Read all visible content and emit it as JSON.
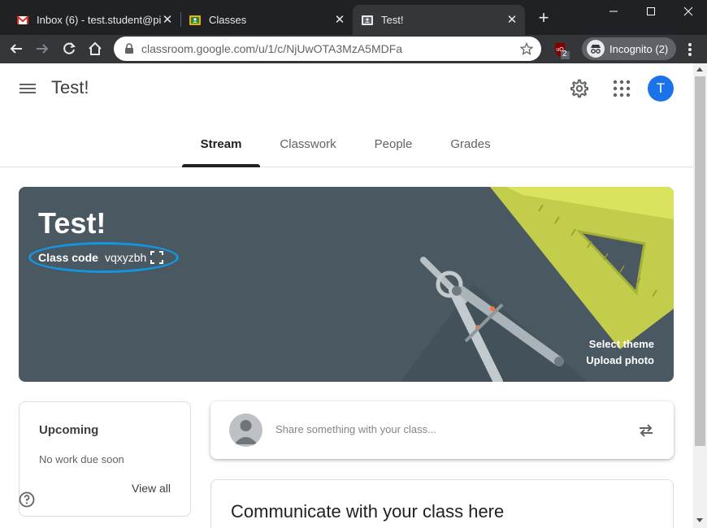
{
  "browser": {
    "tabs": [
      {
        "title": "Inbox (6) - test.student@pin",
        "favicon": "gmail-icon",
        "active": false
      },
      {
        "title": "Classes",
        "favicon": "classroom-icon",
        "active": false
      },
      {
        "title": "Test!",
        "favicon": "classroom-icon",
        "active": true
      }
    ],
    "url": "classroom.google.com/u/1/c/NjUwOTA3MzA5MDFa",
    "extension_badge": "2",
    "incognito_label": "Incognito (2)"
  },
  "app": {
    "title": "Test!",
    "avatar_letter": "T",
    "tabs": [
      {
        "label": "Stream",
        "active": true
      },
      {
        "label": "Classwork",
        "active": false
      },
      {
        "label": "People",
        "active": false
      },
      {
        "label": "Grades",
        "active": false
      }
    ]
  },
  "banner": {
    "title": "Test!",
    "class_code_label": "Class code",
    "class_code_value": "vqxyzbh",
    "select_theme": "Select theme",
    "upload_photo": "Upload photo",
    "background_color": "#4a5961",
    "highlight_color": "#1296e0"
  },
  "upcoming": {
    "heading": "Upcoming",
    "status": "No work due soon",
    "view_all": "View all"
  },
  "share": {
    "placeholder": "Share something with your class..."
  },
  "communicate": {
    "heading": "Communicate with your class here"
  }
}
